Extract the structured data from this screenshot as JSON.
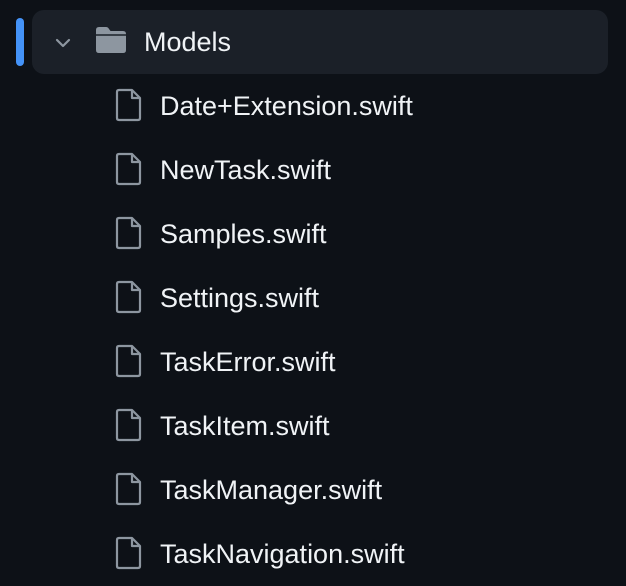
{
  "colors": {
    "background": "#0d1117",
    "selected_row": "#1b2028",
    "active_indicator": "#4493f8",
    "text": "#f0f3f6",
    "icon": "#8d96a0"
  },
  "folder": {
    "name": "Models",
    "expanded": true,
    "icon": "folder-icon",
    "chevron": "chevron-down-icon"
  },
  "files": [
    {
      "name": "Date+Extension.swift",
      "icon": "file-icon"
    },
    {
      "name": "NewTask.swift",
      "icon": "file-icon"
    },
    {
      "name": "Samples.swift",
      "icon": "file-icon"
    },
    {
      "name": "Settings.swift",
      "icon": "file-icon"
    },
    {
      "name": "TaskError.swift",
      "icon": "file-icon"
    },
    {
      "name": "TaskItem.swift",
      "icon": "file-icon"
    },
    {
      "name": "TaskManager.swift",
      "icon": "file-icon"
    },
    {
      "name": "TaskNavigation.swift",
      "icon": "file-icon"
    }
  ]
}
